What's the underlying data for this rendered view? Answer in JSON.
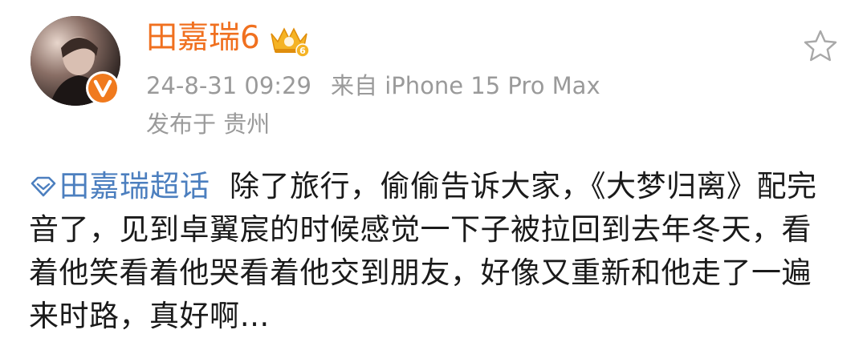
{
  "post": {
    "username": "田嘉瑞6",
    "timestamp": "24-8-31 09:29",
    "source": "来自 iPhone 15 Pro Max",
    "location": "发布于 贵州",
    "topic_label": "田嘉瑞超话",
    "body_text": "除了旅行，偷偷告诉大家，《大梦归离》配完音了，见到卓翼宸的时候感觉一下子被拉回到去年冬天，看着他笑看着他哭看着他交到朋友，好像又重新和他走了一遍来时路，真好啊…",
    "icons": {
      "crown": "crown-level-6-icon",
      "verified": "verified-v-icon",
      "favorite": "star-outline-icon",
      "topic": "super-topic-diamond-icon"
    },
    "colors": {
      "username": "#f0701f",
      "meta": "#9a9a9a",
      "topic": "#4c7fbf",
      "body": "#1a1a1a",
      "verified": "#f07a1e"
    }
  }
}
